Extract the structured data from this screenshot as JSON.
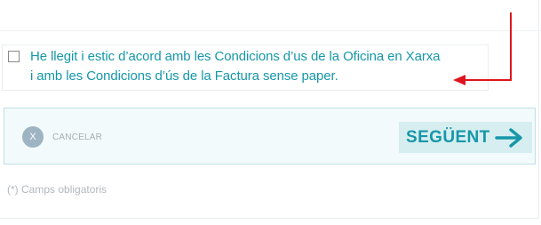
{
  "terms": {
    "checked": false,
    "line1": "He llegit i estic d’acord amb les Condicions d’us de la Oficina en Xarxa",
    "line2": "i amb les Condicions d’ús de la Factura sense paper."
  },
  "actions": {
    "cancel_icon_text": "X",
    "cancel_label": "CANCELAR",
    "next_label": "SEGÜENT"
  },
  "footer": {
    "required_note": "(*) Camps obligatoris"
  },
  "colors": {
    "accent": "#1697a9",
    "annotation_arrow": "#e0141c",
    "action_bar_bg": "#f2fafb",
    "next_button_bg": "#d7eef1"
  },
  "icons": {
    "cancel": "close-icon",
    "next": "arrow-right-icon",
    "annotation": "annotation-arrow"
  }
}
